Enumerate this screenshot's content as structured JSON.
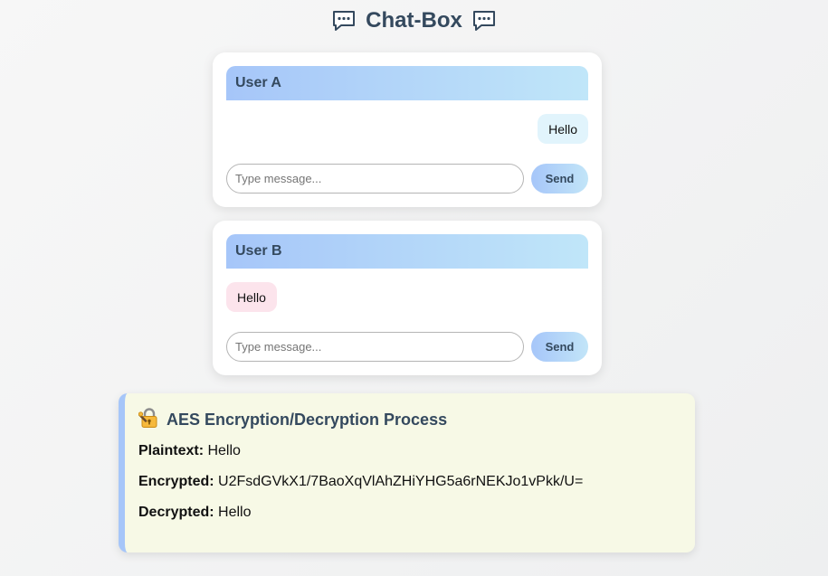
{
  "page": {
    "title": "Chat-Box"
  },
  "user_a": {
    "name": "User A",
    "messages": [
      {
        "text": "Hello",
        "side": "right"
      }
    ],
    "input_placeholder": "Type message...",
    "input_value": "",
    "send_label": "Send"
  },
  "user_b": {
    "name": "User B",
    "messages": [
      {
        "text": "Hello",
        "side": "left"
      }
    ],
    "input_placeholder": "Type message...",
    "input_value": "",
    "send_label": "Send"
  },
  "process": {
    "icon": "lock-key-icon",
    "title": "AES Encryption/Decryption Process",
    "plaintext_label": "Plaintext:",
    "plaintext_value": "Hello",
    "encrypted_label": "Encrypted:",
    "encrypted_value": "U2FsdGVkX1/7BaoXqVlAhZHiYHG5a6rNEKJo1vPkk/U=",
    "decrypted_label": "Decrypted:",
    "decrypted_value": "Hello"
  },
  "colors": {
    "accent_blue": "#a6c6f9",
    "accent_light_blue": "#c0e6f9",
    "bubble_a": "#e1f4fc",
    "bubble_b": "#fce4ec",
    "process_bg": "#f7f9e6",
    "heading": "#34495e"
  }
}
